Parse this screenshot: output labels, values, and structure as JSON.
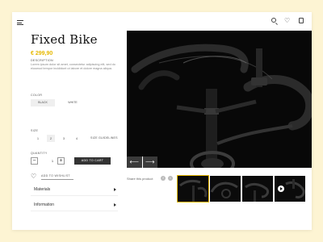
{
  "product": {
    "title": "Fixed Bike",
    "price": "€ 299,90",
    "description_label": "DESCRIPTION",
    "description": "Lorem ipsum dolor sit amet, consectetur adipiscing elit, sed do eiusmod tempor incididunt ut labore et dolore magna aliqua.",
    "color_label": "COLOR",
    "colors": [
      "BLACK",
      "WHITE"
    ],
    "selected_color": "BLACK",
    "size_label": "SIZE",
    "sizes": [
      "1",
      "2",
      "3",
      "4"
    ],
    "selected_size": "2",
    "size_guidelines": "SIZE GUIDELINES",
    "quantity_label": "QUANTITY",
    "quantity": "1",
    "qty_minus": "−",
    "qty_plus": "+",
    "add_to_cart": "ADD TO CART",
    "wishlist": "ADD TO WISHLIST",
    "accordions": [
      "Materials",
      "Information"
    ]
  },
  "gallery": {
    "prev": "⟵",
    "next": "⟶",
    "share_label": "Share this product",
    "share_icons": [
      "f",
      "t"
    ],
    "thumb_count": 4,
    "selected_thumb": 0
  },
  "icons": {
    "heart": "♡",
    "accent": "#e6b800"
  }
}
